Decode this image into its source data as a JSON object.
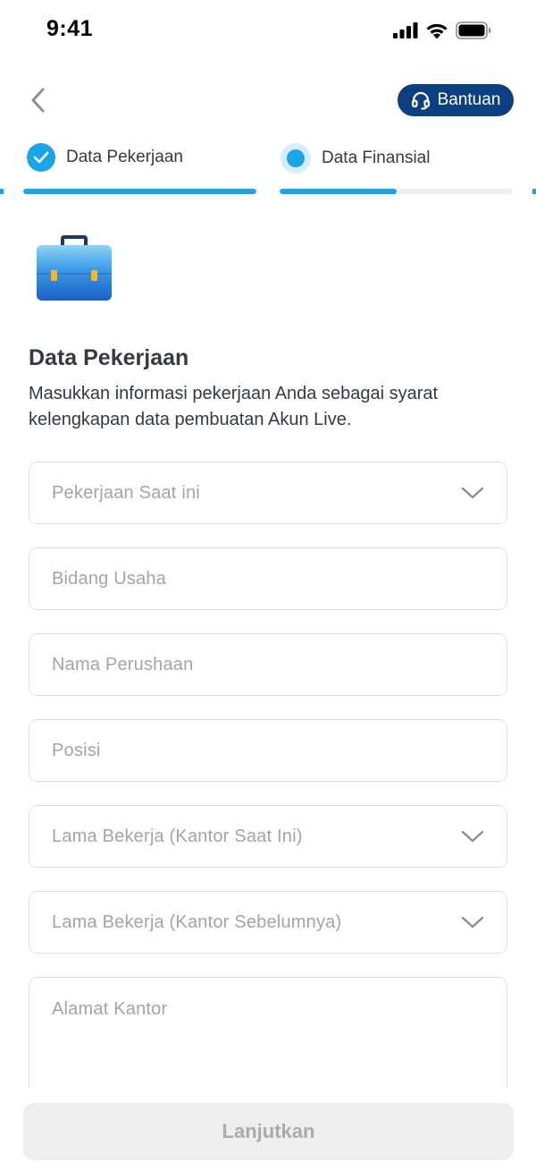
{
  "status_bar": {
    "time": "9:41",
    "icons": [
      "signal-icon",
      "wifi-icon",
      "battery-icon"
    ]
  },
  "header": {
    "back_icon": "chevron-left-icon",
    "help_label": "Bantuan",
    "help_icon": "headset-icon",
    "help_color": "#0b3f7f"
  },
  "stepper": {
    "steps": [
      {
        "label": "Data Pekerjaan",
        "state": "completed",
        "progress": 1.0
      },
      {
        "label": "Data Finansial",
        "state": "active",
        "progress": 0.5
      }
    ],
    "accent_color": "#1aa5e8"
  },
  "content": {
    "illustration_icon": "briefcase-icon",
    "title": "Data Pekerjaan",
    "description": "Masukkan informasi pekerjaan Anda sebagai syarat kelengkapan data pembuatan Akun Live."
  },
  "form": {
    "fields": [
      {
        "placeholder": "Pekerjaan Saat ini",
        "type": "select"
      },
      {
        "placeholder": "Bidang Usaha",
        "type": "text"
      },
      {
        "placeholder": "Nama Perushaan",
        "type": "text"
      },
      {
        "placeholder": "Posisi",
        "type": "text"
      },
      {
        "placeholder": "Lama Bekerja (Kantor Saat Ini)",
        "type": "select"
      },
      {
        "placeholder": "Lama Bekerja (Kantor Sebelumnya)",
        "type": "select"
      },
      {
        "placeholder": "Alamat Kantor",
        "type": "textarea"
      }
    ]
  },
  "footer": {
    "submit_label": "Lanjutkan",
    "submit_state": "disabled"
  }
}
